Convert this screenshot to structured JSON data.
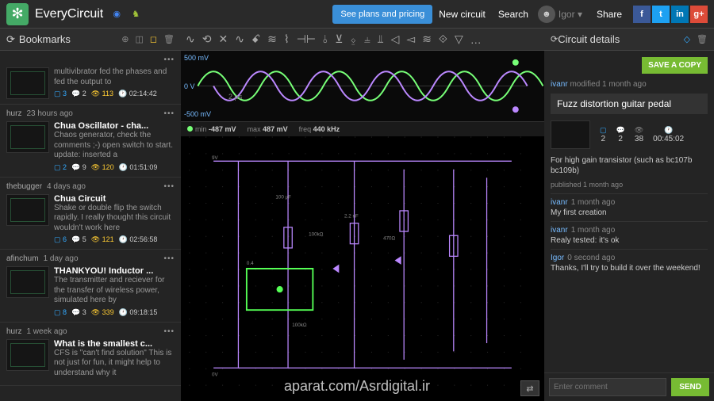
{
  "header": {
    "brand": "EveryCircuit",
    "plans_btn": "See plans and pricing",
    "new_circuit": "New circuit",
    "search": "Search",
    "user": "Igor",
    "share": "Share"
  },
  "sidebar": {
    "title": "Bookmarks",
    "posts": [
      {
        "author": "",
        "time": "",
        "title": "",
        "desc": "multivibrator fed the phases and fed the output to",
        "b": "3",
        "c": "2",
        "v": "113",
        "t": "02:14:42"
      },
      {
        "author": "hurz",
        "time": "23 hours ago",
        "title": "Chua Oscillator - cha...",
        "desc": "Chaos generator, check the comments ;-) open switch to start. update: inserted a",
        "b": "2",
        "c": "9",
        "v": "120",
        "t": "01:51:09"
      },
      {
        "author": "thebugger",
        "time": "4 days ago",
        "title": "Chua Circuit",
        "desc": "Shake or double flip the switch rapidly. I really thought this circuit wouldn't work here",
        "b": "6",
        "c": "5",
        "v": "121",
        "t": "02:56:58"
      },
      {
        "author": "afinchum",
        "time": "1 day ago",
        "title": "THANKYOU! Inductor ...",
        "desc": "The transmitter and reciever for the transfer of wireless power, simulated here by",
        "b": "8",
        "c": "3",
        "v": "339",
        "t": "09:18:15"
      },
      {
        "author": "hurz",
        "time": "1 week ago",
        "title": "What is the smallest c...",
        "desc": "CFS is \"can't find solution\" This is not just for fun, it might help to understand why it",
        "b": "",
        "c": "",
        "v": "",
        "t": ""
      }
    ]
  },
  "toolbar_icons": [
    "∿",
    "⟲",
    "✕",
    "∿",
    "ꗃ",
    "≋",
    "⌇",
    "⊣⊢",
    "⫰",
    "⊻",
    "⍚",
    "⫨",
    "⫫",
    "◁",
    "◅",
    "≋",
    "⟐",
    "▽",
    "…"
  ],
  "scope": {
    "top": "500 mV",
    "mid": "0 V",
    "bot": "-500 mV",
    "time": "2 µs"
  },
  "readout": {
    "min_l": "min",
    "min": "-487 mV",
    "max_l": "max",
    "max": "487 mV",
    "freq_l": "freq",
    "freq": "440 kHz"
  },
  "rpanel": {
    "title": "Circuit details",
    "save": "SAVE A COPY",
    "mod_author": "ivanr",
    "mod_text": " modified 1 month ago",
    "name": "Fuzz distortion guitar pedal",
    "stats": {
      "b": "2",
      "c": "2",
      "v": "38",
      "t": "00:45:02"
    },
    "desc": "For high gain transistor (such as bc107b bc109b)",
    "published": "published 1 month ago",
    "comments": [
      {
        "a": "ivanr",
        "t": "1 month ago",
        "b": "My first creation"
      },
      {
        "a": "ivanr",
        "t": "1 month ago",
        "b": "Realy tested: it's ok"
      },
      {
        "a": "Igor",
        "t": "0 second ago",
        "b": "Thanks, I'll try to build it over the weekend!"
      }
    ],
    "placeholder": "Enter comment",
    "send": "SEND"
  },
  "watermark": "aparat.com/Asrdigital.ir"
}
